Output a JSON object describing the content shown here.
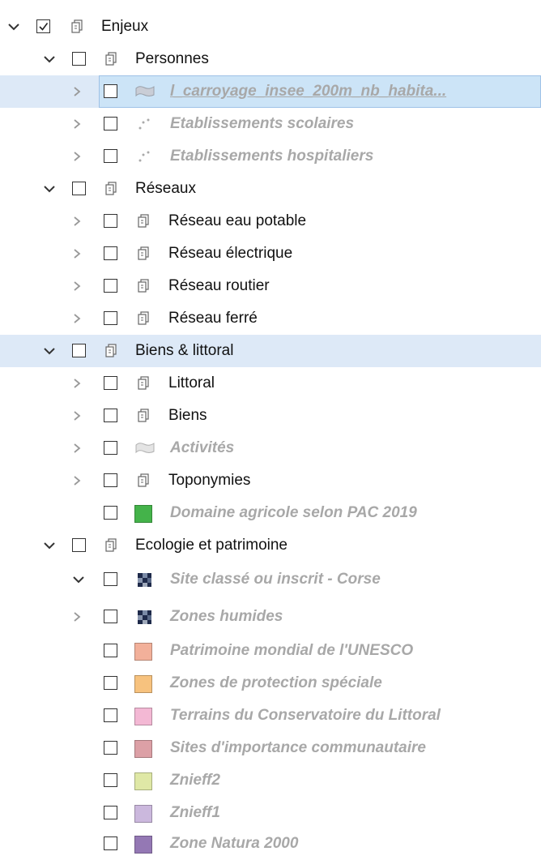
{
  "tree": {
    "root": {
      "label": "Enjeux",
      "icon": "layer-group-icon",
      "checked": true,
      "expanded": true
    },
    "personnes": {
      "label": "Personnes",
      "icon": "layer-group-icon",
      "items": [
        {
          "label": "l_carroyage_insee_200m_nb_habita...",
          "icon": "polygon-layer-icon"
        },
        {
          "label": "Etablissements scolaires",
          "icon": "point-layer-icon"
        },
        {
          "label": "Etablissements hospitaliers",
          "icon": "point-layer-icon"
        }
      ]
    },
    "reseaux": {
      "label": "Réseaux",
      "icon": "layer-group-icon",
      "items": [
        {
          "label": "Réseau eau potable",
          "icon": "layer-group-icon"
        },
        {
          "label": "Réseau électrique",
          "icon": "layer-group-icon"
        },
        {
          "label": "Réseau routier",
          "icon": "layer-group-icon"
        },
        {
          "label": "Réseau ferré",
          "icon": "layer-group-icon"
        }
      ]
    },
    "biens": {
      "label": "Biens & littoral",
      "icon": "layer-group-icon",
      "items": [
        {
          "label": "Littoral",
          "icon": "layer-group-icon"
        },
        {
          "label": "Biens",
          "icon": "layer-group-icon"
        },
        {
          "label": "Activités",
          "icon": "polygon-layer-icon"
        },
        {
          "label": "Toponymies",
          "icon": "layer-group-icon"
        },
        {
          "label": "Domaine agricole selon PAC 2019",
          "swatch": "#44b34a"
        }
      ]
    },
    "ecologie": {
      "label": "Ecologie et patrimoine",
      "icon": "layer-group-icon",
      "items": [
        {
          "label": "Site classé ou inscrit  - Corse",
          "icon": "raster-layer-icon"
        },
        {
          "label": "Zones humides",
          "icon": "raster-layer-icon"
        },
        {
          "label": "Patrimoine mondial de l'UNESCO",
          "swatch": "#f2b09a"
        },
        {
          "label": "Zones de protection spéciale",
          "swatch": "#f7c27e"
        },
        {
          "label": "Terrains du Conservatoire du Littoral",
          "swatch": "#f3b8d4"
        },
        {
          "label": "Sites d'importance communautaire",
          "swatch": "#dca0a6"
        },
        {
          "label": "Znieff2",
          "swatch": "#dfe8a6"
        },
        {
          "label": "Znieff1",
          "swatch": "#cbb8dd"
        },
        {
          "label": "Zone Natura 2000",
          "swatch": "#9478b4"
        }
      ]
    }
  }
}
